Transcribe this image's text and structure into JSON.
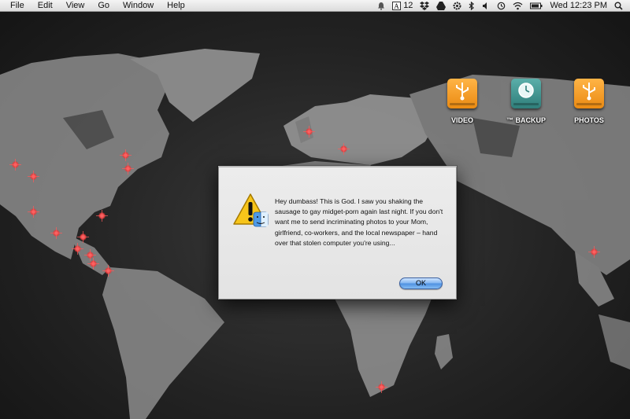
{
  "menubar": {
    "apple_icon": "apple-icon",
    "menus": [
      "File",
      "Edit",
      "View",
      "Go",
      "Window",
      "Help"
    ],
    "status": {
      "notification_count": "12",
      "datetime": "Wed 12:23 PM"
    }
  },
  "desktop": {
    "drives": [
      {
        "label": "VIDEO",
        "color": "#f39a1e",
        "icon": "usb-icon"
      },
      {
        "label": "™ BACKUP",
        "color": "#3f8f8b",
        "icon": "time-machine-icon"
      },
      {
        "label": "PHOTOS",
        "color": "#f39a1e",
        "icon": "usb-icon"
      }
    ]
  },
  "alert": {
    "icon": "warning-icon",
    "message": "Hey dumbass! This is God. I saw you shaking the sausage to gay midget-porn again last night. If you don't want me to send incriminating photos to your Mom, girlfriend, co-workers, and the local newspaper – hand over that stolen computer you're using...",
    "ok_label": "OK"
  },
  "colors": {
    "marker": "#e84040",
    "button_accent": "#4d8fe0"
  }
}
